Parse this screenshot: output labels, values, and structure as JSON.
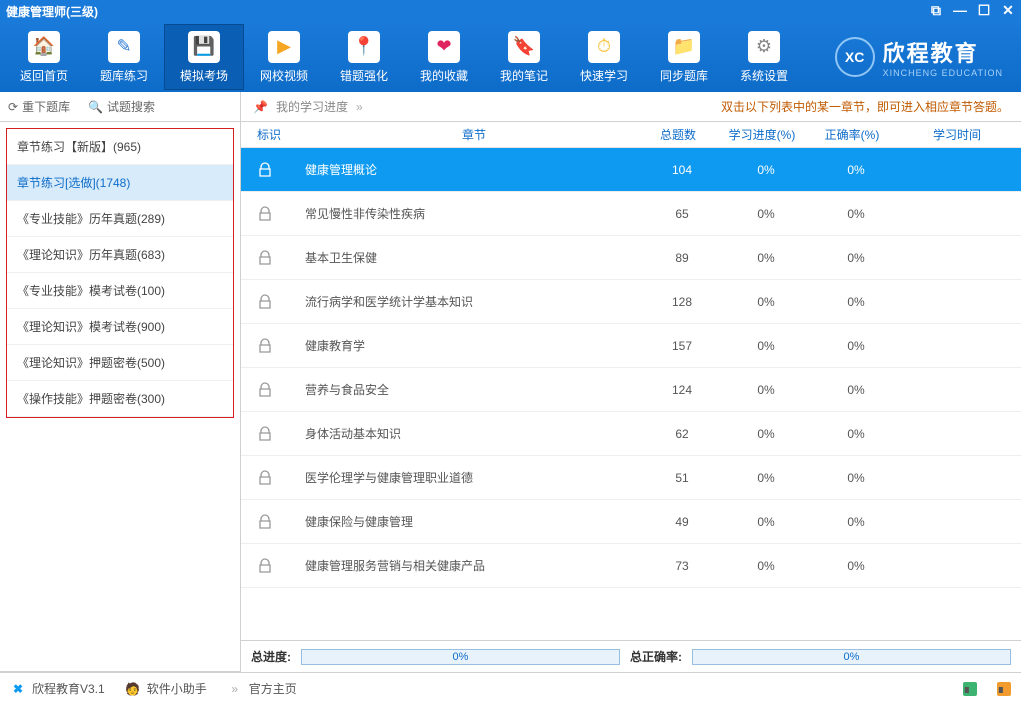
{
  "window_title": "健康管理师(三级)",
  "toolbar": [
    {
      "id": "home",
      "label": "返回首页"
    },
    {
      "id": "bank",
      "label": "题库练习"
    },
    {
      "id": "exam",
      "label": "模拟考场"
    },
    {
      "id": "video",
      "label": "网校视频"
    },
    {
      "id": "wrong",
      "label": "错题强化"
    },
    {
      "id": "fav",
      "label": "我的收藏"
    },
    {
      "id": "notes",
      "label": "我的笔记"
    },
    {
      "id": "quick",
      "label": "快速学习"
    },
    {
      "id": "sync",
      "label": "同步题库"
    },
    {
      "id": "settings",
      "label": "系统设置"
    }
  ],
  "toolbar_active": "exam",
  "brand": {
    "cn": "欣程教育",
    "en": "XINCHENG EDUCATION",
    "logo": "XC"
  },
  "sidebar": {
    "refresh": "重下题库",
    "search": "试题搜索",
    "items": [
      "章节练习【新版】(965)",
      "章节练习[选做](1748)",
      "《专业技能》历年真题(289)",
      "《理论知识》历年真题(683)",
      "《专业技能》模考试卷(100)",
      "《理论知识》模考试卷(900)",
      "《理论知识》押题密卷(500)",
      "《操作技能》押题密卷(300)"
    ],
    "selected": 1
  },
  "main": {
    "progress_label": "我的学习进度",
    "hint": "双击以下列表中的某一章节，即可进入相应章节答题。",
    "columns": {
      "flag": "标识",
      "chapter": "章节",
      "total": "总题数",
      "progress": "学习进度(%)",
      "accuracy": "正确率(%)",
      "time": "学习时间"
    },
    "rows": [
      {
        "chapter": "健康管理概论",
        "total": 104,
        "progress": "0%",
        "accuracy": "0%"
      },
      {
        "chapter": "常见慢性非传染性疾病",
        "total": 65,
        "progress": "0%",
        "accuracy": "0%"
      },
      {
        "chapter": "基本卫生保健",
        "total": 89,
        "progress": "0%",
        "accuracy": "0%"
      },
      {
        "chapter": "流行病学和医学统计学基本知识",
        "total": 128,
        "progress": "0%",
        "accuracy": "0%"
      },
      {
        "chapter": "健康教育学",
        "total": 157,
        "progress": "0%",
        "accuracy": "0%"
      },
      {
        "chapter": "营养与食品安全",
        "total": 124,
        "progress": "0%",
        "accuracy": "0%"
      },
      {
        "chapter": "身体活动基本知识",
        "total": 62,
        "progress": "0%",
        "accuracy": "0%"
      },
      {
        "chapter": "医学伦理学与健康管理职业道德",
        "total": 51,
        "progress": "0%",
        "accuracy": "0%"
      },
      {
        "chapter": "健康保险与健康管理",
        "total": 49,
        "progress": "0%",
        "accuracy": "0%"
      },
      {
        "chapter": "健康管理服务营销与相关健康产品",
        "total": 73,
        "progress": "0%",
        "accuracy": "0%"
      }
    ],
    "row_active": 0,
    "footer": {
      "total_progress_label": "总进度:",
      "total_progress": "0%",
      "total_accuracy_label": "总正确率:",
      "total_accuracy": "0%"
    }
  },
  "status": {
    "app": "欣程教育V3.1",
    "helper": "软件小助手",
    "homepage": "官方主页"
  }
}
